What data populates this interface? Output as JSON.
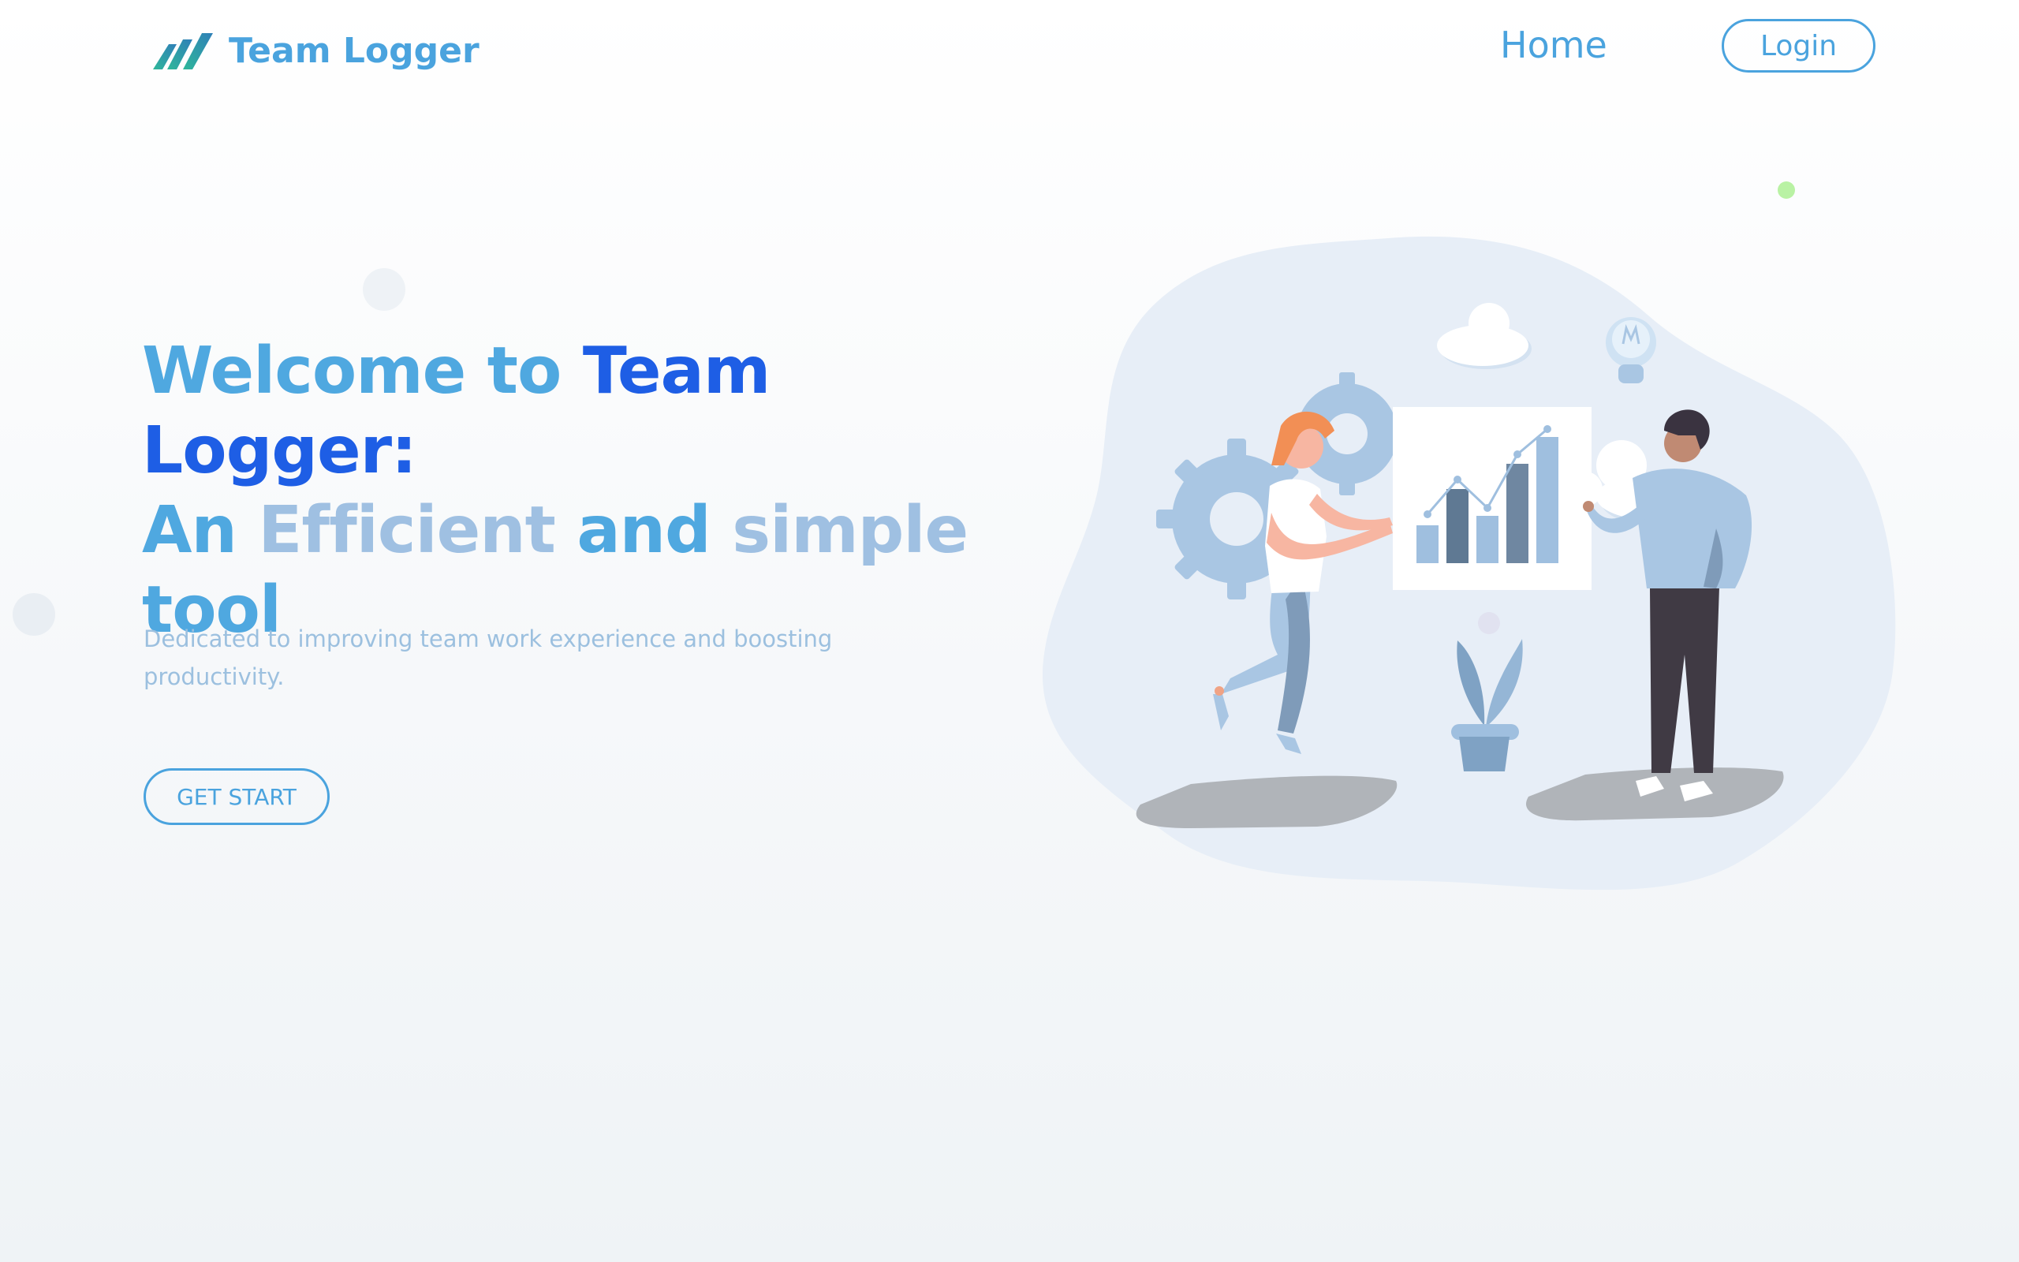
{
  "header": {
    "brand": "Team Logger",
    "logo_icon": "stripes-logo-icon",
    "nav": {
      "home_label": "Home"
    },
    "login_label": "Login"
  },
  "hero": {
    "title_parts": {
      "p1": "Welcome to ",
      "p2": "Team Logger:",
      "p3": "An ",
      "p4": "Efficient",
      "p5": " and ",
      "p6": "simple",
      "p7": "tool"
    },
    "subtitle": "Dedicated to improving team work experience and boosting productivity.",
    "cta_label": "GET START"
  },
  "colors": {
    "accent": "#4aa3de",
    "title_dark": "#1e5ee5",
    "title_light": "#9fc0e2",
    "subtitle": "#9cc0df",
    "logo_green": "#2fb89a"
  },
  "illustration": {
    "name": "team-presentation-illustration",
    "elements": [
      "woman-figure",
      "man-figure",
      "bar-chart-board",
      "gears",
      "clouds",
      "lightbulb-icon",
      "potted-plant"
    ]
  }
}
